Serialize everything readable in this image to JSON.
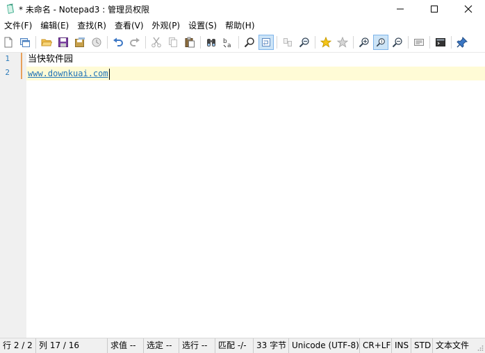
{
  "window": {
    "title": "* 未命名 - Notepad3 : 管理员权限",
    "app_icon": "notepad3-icon"
  },
  "menu": [
    {
      "label": "文件(F)",
      "name": "menu-file"
    },
    {
      "label": "编辑(E)",
      "name": "menu-edit"
    },
    {
      "label": "查找(R)",
      "name": "menu-find"
    },
    {
      "label": "查看(V)",
      "name": "menu-view"
    },
    {
      "label": "外观(P)",
      "name": "menu-appearance"
    },
    {
      "label": "设置(S)",
      "name": "menu-settings"
    },
    {
      "label": "帮助(H)",
      "name": "menu-help"
    }
  ],
  "toolbar_icons": [
    "new-file-icon",
    "new-window-icon",
    "open-folder-icon",
    "save-icon",
    "save-as-icon",
    "browse-icon",
    "undo-icon",
    "redo-icon",
    "cut-icon",
    "copy-icon",
    "paste-icon",
    "find-icon",
    "replace-icon",
    "goto-icon",
    "word-wrap-icon",
    "split-icon",
    "zoom-find-icon",
    "bookmark-star-icon",
    "bookmark-clear-icon",
    "zoom-in-icon",
    "zoom-reset-icon",
    "zoom-out-icon",
    "properties-icon",
    "console-icon",
    "pin-icon"
  ],
  "editor": {
    "lines": [
      {
        "number": "1",
        "text": "当快软件园"
      },
      {
        "number": "2",
        "text": "www.downkuai.com"
      }
    ]
  },
  "statusbar": {
    "line": "行  2 / 2",
    "col": "列  17 / 16",
    "value": "求值  --",
    "selection": "选定  --",
    "sel_lines": "选行  --",
    "match": "匹配  -/-",
    "bytes": "33 字节",
    "encoding": "Unicode (UTF-8)",
    "eol": "CR+LF",
    "ins": "INS",
    "std": "STD",
    "filetype": "文本文件"
  },
  "colors": {
    "line_number": "#2b7ab9",
    "current_line": "#fffbd6",
    "link_text": "#1f73b8",
    "gutter_marker": "#e8a05a"
  }
}
